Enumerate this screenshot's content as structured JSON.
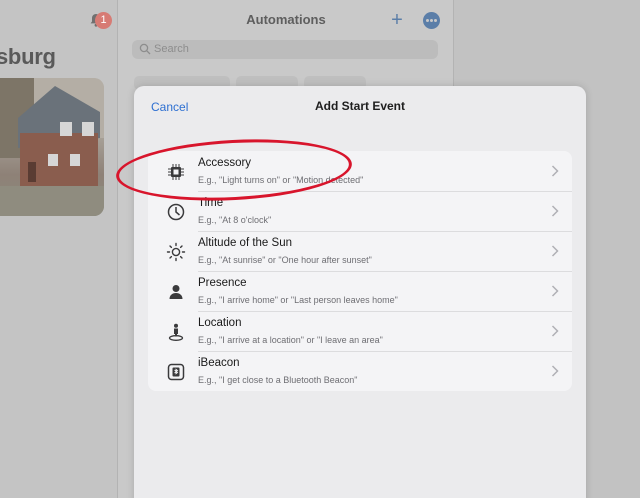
{
  "background": {
    "home_title": "sburg",
    "notification_count": "1",
    "automations_title": "Automations",
    "search_placeholder": "Search"
  },
  "sheet": {
    "cancel_label": "Cancel",
    "title": "Add Start Event"
  },
  "events": [
    {
      "title": "Accessory",
      "subtitle": "E.g., \"Light turns on\" or \"Motion detected\"",
      "icon": "accessory-chip-icon"
    },
    {
      "title": "Time",
      "subtitle": "E.g., \"At 8 o'clock\"",
      "icon": "clock-icon"
    },
    {
      "title": "Altitude of the Sun",
      "subtitle": "E.g., \"At sunrise\" or \"One hour after sunset\"",
      "icon": "sun-icon"
    },
    {
      "title": "Presence",
      "subtitle": "E.g., \"I arrive home\" or \"Last person leaves home\"",
      "icon": "person-icon"
    },
    {
      "title": "Location",
      "subtitle": "E.g., \"I arrive at a location\" or \"I leave an area\"",
      "icon": "location-person-icon"
    },
    {
      "title": "iBeacon",
      "subtitle": "E.g., \"I get close to a Bluetooth Beacon\"",
      "icon": "beacon-icon"
    }
  ],
  "colors": {
    "accent": "#2d6fd1",
    "annotation": "#d8152c",
    "badge": "#d77b74"
  }
}
